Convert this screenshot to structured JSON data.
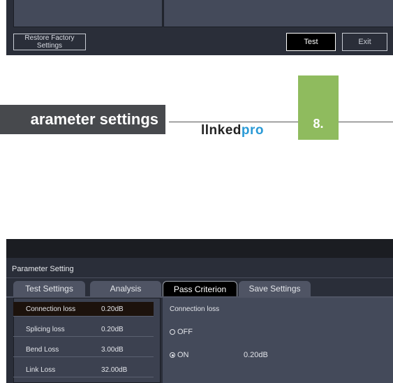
{
  "top_screen": {
    "restore_button": "Restore Factory\nSettings",
    "test_button": "Test",
    "exit_button": "Exit"
  },
  "section": {
    "title": "arameter settings",
    "brand_prefix": "llnked",
    "brand_suffix": "pro",
    "page_number": "8."
  },
  "device": {
    "window_title": "Parameter Setting",
    "tabs": [
      {
        "label": "Test Settings",
        "active": false
      },
      {
        "label": "Analysis",
        "active": false
      },
      {
        "label": "Pass Criterion",
        "active": true
      },
      {
        "label": "Save Settings",
        "active": false
      }
    ],
    "criteria": [
      {
        "name": "Connection loss",
        "value": "0.20dB",
        "selected": true
      },
      {
        "name": "Splicing loss",
        "value": "0.20dB",
        "selected": false
      },
      {
        "name": "Bend Loss",
        "value": "3.00dB",
        "selected": false
      },
      {
        "name": "Link Loss",
        "value": "32.00dB",
        "selected": false
      }
    ],
    "detail": {
      "heading": "Connection loss",
      "option_off": "OFF",
      "option_on": "ON",
      "on_value": "0.20dB",
      "selected_option": "ON"
    }
  },
  "colors": {
    "accent_green": "#8fbb5e",
    "brand_blue": "#2a9ad6",
    "device_bg": "#2a2e39"
  }
}
